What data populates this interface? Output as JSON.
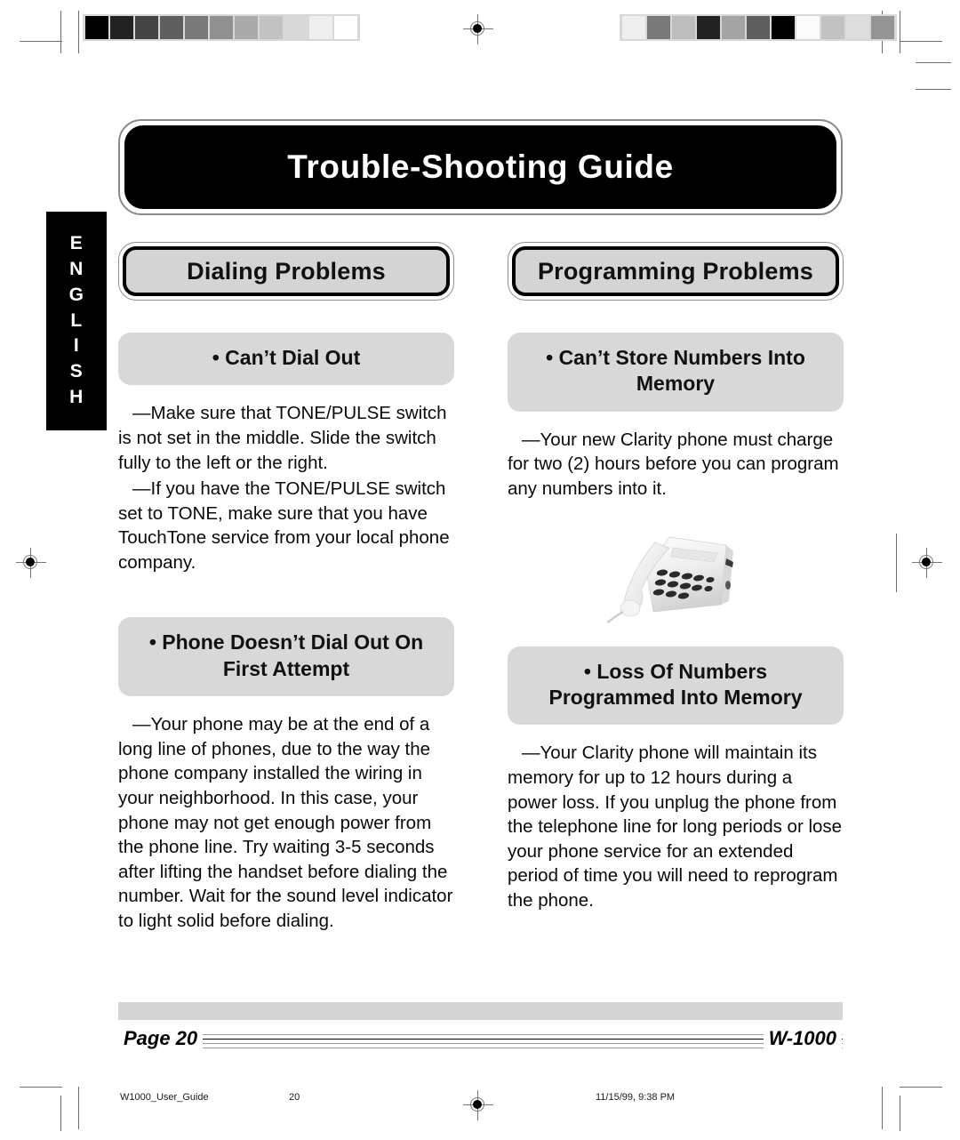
{
  "document": {
    "title": "Trouble-Shooting Guide",
    "language_tab": [
      "E",
      "N",
      "G",
      "L",
      "I",
      "S",
      "H"
    ]
  },
  "columns": {
    "left": {
      "heading": "Dialing Problems",
      "sections": [
        {
          "pill_lines": [
            "• Can’t Dial Out"
          ],
          "paragraphs": [
            "—Make sure that TONE/PULSE switch is not set in the middle. Slide the switch fully to the left or the right.",
            "—If you have the TONE/PULSE switch set to TONE, make sure that you have TouchTone service from your local phone company."
          ]
        },
        {
          "pill_lines": [
            "• Phone Doesn’t Dial Out On",
            "First Attempt"
          ],
          "paragraphs": [
            "—Your phone may be at the end of a long line of phones, due to the way the phone company installed the wiring in your neighborhood. In this case, your phone may not get enough power from the phone line. Try waiting 3-5 seconds after lifting the handset before dialing the number. Wait for the sound level indicator to light solid before dialing."
          ]
        }
      ]
    },
    "right": {
      "heading": "Programming Problems",
      "sections": [
        {
          "pill_lines": [
            "• Can’t Store Numbers Into",
            "Memory"
          ],
          "paragraphs": [
            "—Your new Clarity phone must charge for two (2) hours before you can program any numbers into it."
          ]
        },
        {
          "pill_lines": [
            "• Loss Of Numbers",
            "Programmed Into Memory"
          ],
          "paragraphs": [
            "—Your Clarity phone will maintain its memory for up to 12 hours during a power loss. If you unplug the phone from the telephone line for long periods or lose your phone service for an extended period of time you will need to reprogram the phone."
          ]
        }
      ]
    }
  },
  "illustration": {
    "name": "corded-desk-telephone-photo",
    "description": "White corded desk telephone with handset and keypad"
  },
  "footer": {
    "page_label": "Page 20",
    "model_label": "W-1000"
  },
  "print_slug": {
    "filename": "W1000_User_Guide",
    "page_number": "20",
    "timestamp": "11/15/99, 9:38 PM"
  },
  "calibration": {
    "left_strip": [
      "#000000",
      "#222222",
      "#444444",
      "#5e5e5e",
      "#787878",
      "#909090",
      "#aaaaaa",
      "#c2c2c2",
      "#d9d9d9",
      "#eeeeee",
      "#ffffff"
    ],
    "right_strip": [
      "#eeeeee",
      "#787878",
      "#bdbdbd",
      "#222222",
      "#a4a4a4",
      "#5e5e5e",
      "#000000",
      "#fbfbfb",
      "#c2c2c2",
      "#dddddd",
      "#949494"
    ]
  },
  "colors": {
    "banner_background": "#000000",
    "banner_text": "#ffffff",
    "plate_fill": "#d4d4d4",
    "pill_fill": "#d8d8d8",
    "footer_bar": "#d5d5d5"
  }
}
